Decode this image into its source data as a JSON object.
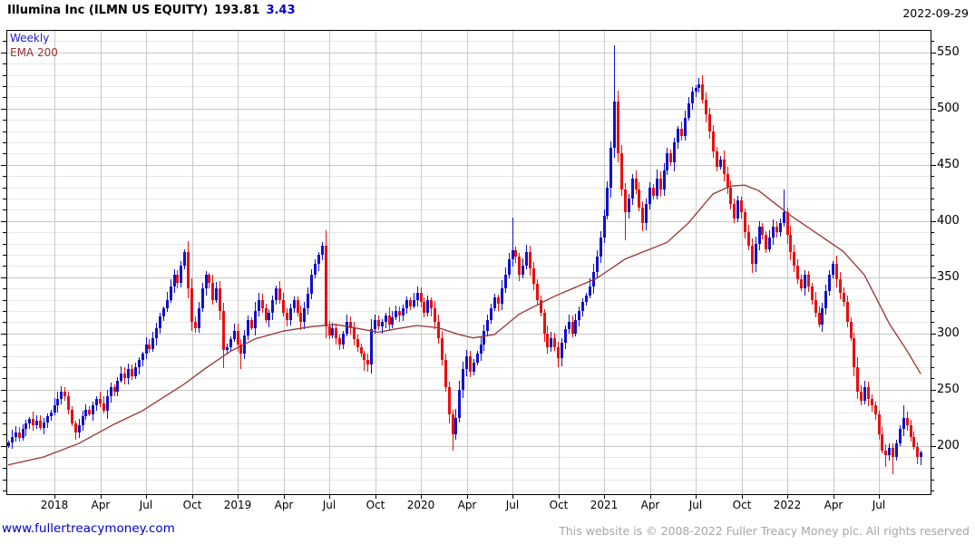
{
  "header": {
    "title": "Illumina Inc (ILMN US EQUITY)",
    "price": "193.81",
    "change": "3.43",
    "date": "2022-09-29"
  },
  "legend": {
    "interval": "Weekly",
    "overlay": "EMA 200"
  },
  "footer": {
    "website": "www.fullertreacymoney.com",
    "copyright": "This website is © 2008-2022 Fuller Treacy Money plc. All rights reserved"
  },
  "colors": {
    "up_candle": "#1111cc",
    "down_candle": "#e81010",
    "ema_line": "#993333",
    "grid_minor": "#e8e8e8",
    "grid_major": "#c6c6c6",
    "grid_vertical": "#c9c9c9",
    "axis": "#000000",
    "change_text": "#0000dd",
    "interval_label": "#2222cc",
    "overlay_label": "#993333",
    "link": "#0000cc",
    "copyright_text": "#a6a6a6"
  },
  "chart_data": {
    "type": "candlestick",
    "title": "Illumina Inc (ILMN US EQUITY)",
    "interval": "Weekly",
    "overlay": "EMA 200",
    "last_price": 193.81,
    "change": 3.43,
    "as_of": "2022-09-29",
    "legend_position": "top-left",
    "grid": true,
    "x_tick_labels": [
      "2018",
      "Apr",
      "Jul",
      "Oct",
      "2019",
      "Apr",
      "Jul",
      "Oct",
      "2020",
      "Apr",
      "Jul",
      "Oct",
      "2021",
      "Apr",
      "Jul",
      "Oct",
      "2022",
      "Apr",
      "Jul"
    ],
    "y_tick_labels": [
      200,
      250,
      300,
      350,
      400,
      450,
      500,
      550
    ],
    "y_minor_step": 10,
    "ylim": [
      157,
      570
    ],
    "weekly_closes": [
      203,
      208,
      212,
      207,
      215,
      220,
      224,
      218,
      222,
      216,
      221,
      226,
      230,
      236,
      242,
      248,
      244,
      232,
      220,
      212,
      218,
      226,
      232,
      228,
      236,
      242,
      238,
      231,
      244,
      252,
      248,
      258,
      264,
      260,
      268,
      262,
      270,
      276,
      282,
      290,
      286,
      296,
      305,
      315,
      322,
      330,
      342,
      352,
      345,
      360,
      372,
      340,
      310,
      305,
      322,
      340,
      352,
      345,
      330,
      340,
      320,
      285,
      288,
      295,
      302,
      290,
      282,
      298,
      312,
      305,
      320,
      330,
      322,
      312,
      318,
      330,
      340,
      330,
      318,
      312,
      322,
      330,
      318,
      310,
      322,
      335,
      352,
      362,
      370,
      378,
      306,
      298,
      305,
      296,
      290,
      300,
      310,
      305,
      295,
      288,
      282,
      276,
      272,
      304,
      312,
      306,
      310,
      316,
      308,
      314,
      320,
      316,
      322,
      330,
      324,
      330,
      336,
      328,
      318,
      330,
      322,
      310,
      296,
      276,
      252,
      228,
      210,
      225,
      250,
      268,
      280,
      266,
      274,
      282,
      290,
      302,
      312,
      322,
      332,
      326,
      340,
      352,
      366,
      374,
      368,
      352,
      360,
      372,
      358,
      344,
      330,
      318,
      300,
      288,
      296,
      288,
      278,
      292,
      304,
      310,
      300,
      312,
      320,
      328,
      334,
      342,
      355,
      368,
      385,
      405,
      430,
      465,
      506,
      460,
      428,
      408,
      420,
      438,
      428,
      412,
      398,
      415,
      430,
      422,
      438,
      428,
      445,
      460,
      452,
      470,
      482,
      476,
      492,
      505,
      515,
      518,
      522,
      508,
      495,
      480,
      462,
      448,
      455,
      442,
      430,
      415,
      402,
      418,
      408,
      390,
      378,
      362,
      380,
      395,
      388,
      375,
      385,
      395,
      390,
      398,
      408,
      388,
      372,
      360,
      348,
      340,
      352,
      342,
      330,
      318,
      308,
      322,
      338,
      352,
      362,
      348,
      336,
      328,
      310,
      296,
      270,
      248,
      240,
      252,
      242,
      236,
      228,
      210,
      196,
      192,
      198,
      190,
      202,
      215,
      225,
      218,
      208,
      199,
      190,
      193.81
    ],
    "wick_overrides": [
      {
        "i": 50,
        "high": 375
      },
      {
        "i": 61,
        "low": 269
      },
      {
        "i": 66,
        "low": 268
      },
      {
        "i": 89,
        "high": 381
      },
      {
        "i": 101,
        "low": 267
      },
      {
        "i": 126,
        "low": 196
      },
      {
        "i": 143,
        "high": 403
      },
      {
        "i": 156,
        "low": 270
      },
      {
        "i": 172,
        "high": 556
      },
      {
        "i": 175,
        "low": 383
      },
      {
        "i": 196,
        "high": 527
      },
      {
        "i": 211,
        "low": 354
      },
      {
        "i": 220,
        "high": 428
      },
      {
        "i": 249,
        "low": 181
      },
      {
        "i": 251,
        "low": 175
      },
      {
        "i": 254,
        "high": 236
      },
      {
        "i": 259,
        "low": 183
      }
    ],
    "ema200_points": [
      [
        0,
        183
      ],
      [
        10,
        190
      ],
      [
        20,
        202
      ],
      [
        30,
        219
      ],
      [
        38,
        231
      ],
      [
        45,
        245
      ],
      [
        50,
        255
      ],
      [
        56,
        269
      ],
      [
        63,
        284
      ],
      [
        70,
        295
      ],
      [
        78,
        302
      ],
      [
        86,
        306
      ],
      [
        93,
        308
      ],
      [
        100,
        304
      ],
      [
        105,
        301
      ],
      [
        110,
        304
      ],
      [
        116,
        307
      ],
      [
        122,
        305
      ],
      [
        128,
        299
      ],
      [
        132,
        296
      ],
      [
        138,
        299
      ],
      [
        145,
        317
      ],
      [
        155,
        333
      ],
      [
        167,
        349
      ],
      [
        175,
        366
      ],
      [
        187,
        381
      ],
      [
        193,
        398
      ],
      [
        200,
        424
      ],
      [
        205,
        431
      ],
      [
        209,
        432
      ],
      [
        213,
        427
      ],
      [
        222,
        405
      ],
      [
        237,
        373
      ],
      [
        243,
        352
      ],
      [
        250,
        309
      ],
      [
        255,
        285
      ],
      [
        259,
        264
      ]
    ]
  }
}
